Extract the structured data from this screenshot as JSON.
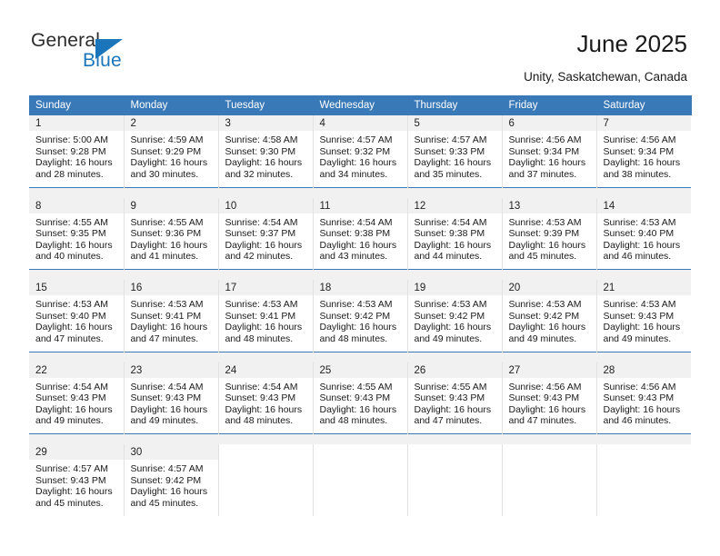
{
  "brand": {
    "name_top": "General",
    "name_bottom": "Blue",
    "accent_color": "#1b75bb"
  },
  "header": {
    "title": "June 2025",
    "subtitle": "Unity, Saskatchewan, Canada"
  },
  "theme": {
    "header_bg": "#3a79b8",
    "daynum_bg": "#f1f1f1",
    "grid_line": "#e2e2e2",
    "text": "#1a1a1a"
  },
  "calendar": {
    "weekday_headers": [
      "Sunday",
      "Monday",
      "Tuesday",
      "Wednesday",
      "Thursday",
      "Friday",
      "Saturday"
    ],
    "labels": {
      "sunrise": "Sunrise:",
      "sunset": "Sunset:",
      "daylight": "Daylight:"
    },
    "weeks": [
      [
        {
          "day": "1",
          "sunrise": "Sunrise: 5:00 AM",
          "sunset": "Sunset: 9:28 PM",
          "daylight_1": "Daylight: 16 hours",
          "daylight_2": "and 28 minutes."
        },
        {
          "day": "2",
          "sunrise": "Sunrise: 4:59 AM",
          "sunset": "Sunset: 9:29 PM",
          "daylight_1": "Daylight: 16 hours",
          "daylight_2": "and 30 minutes."
        },
        {
          "day": "3",
          "sunrise": "Sunrise: 4:58 AM",
          "sunset": "Sunset: 9:30 PM",
          "daylight_1": "Daylight: 16 hours",
          "daylight_2": "and 32 minutes."
        },
        {
          "day": "4",
          "sunrise": "Sunrise: 4:57 AM",
          "sunset": "Sunset: 9:32 PM",
          "daylight_1": "Daylight: 16 hours",
          "daylight_2": "and 34 minutes."
        },
        {
          "day": "5",
          "sunrise": "Sunrise: 4:57 AM",
          "sunset": "Sunset: 9:33 PM",
          "daylight_1": "Daylight: 16 hours",
          "daylight_2": "and 35 minutes."
        },
        {
          "day": "6",
          "sunrise": "Sunrise: 4:56 AM",
          "sunset": "Sunset: 9:34 PM",
          "daylight_1": "Daylight: 16 hours",
          "daylight_2": "and 37 minutes."
        },
        {
          "day": "7",
          "sunrise": "Sunrise: 4:56 AM",
          "sunset": "Sunset: 9:34 PM",
          "daylight_1": "Daylight: 16 hours",
          "daylight_2": "and 38 minutes."
        }
      ],
      [
        {
          "day": "8",
          "sunrise": "Sunrise: 4:55 AM",
          "sunset": "Sunset: 9:35 PM",
          "daylight_1": "Daylight: 16 hours",
          "daylight_2": "and 40 minutes."
        },
        {
          "day": "9",
          "sunrise": "Sunrise: 4:55 AM",
          "sunset": "Sunset: 9:36 PM",
          "daylight_1": "Daylight: 16 hours",
          "daylight_2": "and 41 minutes."
        },
        {
          "day": "10",
          "sunrise": "Sunrise: 4:54 AM",
          "sunset": "Sunset: 9:37 PM",
          "daylight_1": "Daylight: 16 hours",
          "daylight_2": "and 42 minutes."
        },
        {
          "day": "11",
          "sunrise": "Sunrise: 4:54 AM",
          "sunset": "Sunset: 9:38 PM",
          "daylight_1": "Daylight: 16 hours",
          "daylight_2": "and 43 minutes."
        },
        {
          "day": "12",
          "sunrise": "Sunrise: 4:54 AM",
          "sunset": "Sunset: 9:38 PM",
          "daylight_1": "Daylight: 16 hours",
          "daylight_2": "and 44 minutes."
        },
        {
          "day": "13",
          "sunrise": "Sunrise: 4:53 AM",
          "sunset": "Sunset: 9:39 PM",
          "daylight_1": "Daylight: 16 hours",
          "daylight_2": "and 45 minutes."
        },
        {
          "day": "14",
          "sunrise": "Sunrise: 4:53 AM",
          "sunset": "Sunset: 9:40 PM",
          "daylight_1": "Daylight: 16 hours",
          "daylight_2": "and 46 minutes."
        }
      ],
      [
        {
          "day": "15",
          "sunrise": "Sunrise: 4:53 AM",
          "sunset": "Sunset: 9:40 PM",
          "daylight_1": "Daylight: 16 hours",
          "daylight_2": "and 47 minutes."
        },
        {
          "day": "16",
          "sunrise": "Sunrise: 4:53 AM",
          "sunset": "Sunset: 9:41 PM",
          "daylight_1": "Daylight: 16 hours",
          "daylight_2": "and 47 minutes."
        },
        {
          "day": "17",
          "sunrise": "Sunrise: 4:53 AM",
          "sunset": "Sunset: 9:41 PM",
          "daylight_1": "Daylight: 16 hours",
          "daylight_2": "and 48 minutes."
        },
        {
          "day": "18",
          "sunrise": "Sunrise: 4:53 AM",
          "sunset": "Sunset: 9:42 PM",
          "daylight_1": "Daylight: 16 hours",
          "daylight_2": "and 48 minutes."
        },
        {
          "day": "19",
          "sunrise": "Sunrise: 4:53 AM",
          "sunset": "Sunset: 9:42 PM",
          "daylight_1": "Daylight: 16 hours",
          "daylight_2": "and 49 minutes."
        },
        {
          "day": "20",
          "sunrise": "Sunrise: 4:53 AM",
          "sunset": "Sunset: 9:42 PM",
          "daylight_1": "Daylight: 16 hours",
          "daylight_2": "and 49 minutes."
        },
        {
          "day": "21",
          "sunrise": "Sunrise: 4:53 AM",
          "sunset": "Sunset: 9:43 PM",
          "daylight_1": "Daylight: 16 hours",
          "daylight_2": "and 49 minutes."
        }
      ],
      [
        {
          "day": "22",
          "sunrise": "Sunrise: 4:54 AM",
          "sunset": "Sunset: 9:43 PM",
          "daylight_1": "Daylight: 16 hours",
          "daylight_2": "and 49 minutes."
        },
        {
          "day": "23",
          "sunrise": "Sunrise: 4:54 AM",
          "sunset": "Sunset: 9:43 PM",
          "daylight_1": "Daylight: 16 hours",
          "daylight_2": "and 49 minutes."
        },
        {
          "day": "24",
          "sunrise": "Sunrise: 4:54 AM",
          "sunset": "Sunset: 9:43 PM",
          "daylight_1": "Daylight: 16 hours",
          "daylight_2": "and 48 minutes."
        },
        {
          "day": "25",
          "sunrise": "Sunrise: 4:55 AM",
          "sunset": "Sunset: 9:43 PM",
          "daylight_1": "Daylight: 16 hours",
          "daylight_2": "and 48 minutes."
        },
        {
          "day": "26",
          "sunrise": "Sunrise: 4:55 AM",
          "sunset": "Sunset: 9:43 PM",
          "daylight_1": "Daylight: 16 hours",
          "daylight_2": "and 47 minutes."
        },
        {
          "day": "27",
          "sunrise": "Sunrise: 4:56 AM",
          "sunset": "Sunset: 9:43 PM",
          "daylight_1": "Daylight: 16 hours",
          "daylight_2": "and 47 minutes."
        },
        {
          "day": "28",
          "sunrise": "Sunrise: 4:56 AM",
          "sunset": "Sunset: 9:43 PM",
          "daylight_1": "Daylight: 16 hours",
          "daylight_2": "and 46 minutes."
        }
      ],
      [
        {
          "day": "29",
          "sunrise": "Sunrise: 4:57 AM",
          "sunset": "Sunset: 9:43 PM",
          "daylight_1": "Daylight: 16 hours",
          "daylight_2": "and 45 minutes."
        },
        {
          "day": "30",
          "sunrise": "Sunrise: 4:57 AM",
          "sunset": "Sunset: 9:42 PM",
          "daylight_1": "Daylight: 16 hours",
          "daylight_2": "and 45 minutes."
        },
        {
          "day": "",
          "sunrise": "",
          "sunset": "",
          "daylight_1": "",
          "daylight_2": ""
        },
        {
          "day": "",
          "sunrise": "",
          "sunset": "",
          "daylight_1": "",
          "daylight_2": ""
        },
        {
          "day": "",
          "sunrise": "",
          "sunset": "",
          "daylight_1": "",
          "daylight_2": ""
        },
        {
          "day": "",
          "sunrise": "",
          "sunset": "",
          "daylight_1": "",
          "daylight_2": ""
        },
        {
          "day": "",
          "sunrise": "",
          "sunset": "",
          "daylight_1": "",
          "daylight_2": ""
        }
      ]
    ]
  }
}
